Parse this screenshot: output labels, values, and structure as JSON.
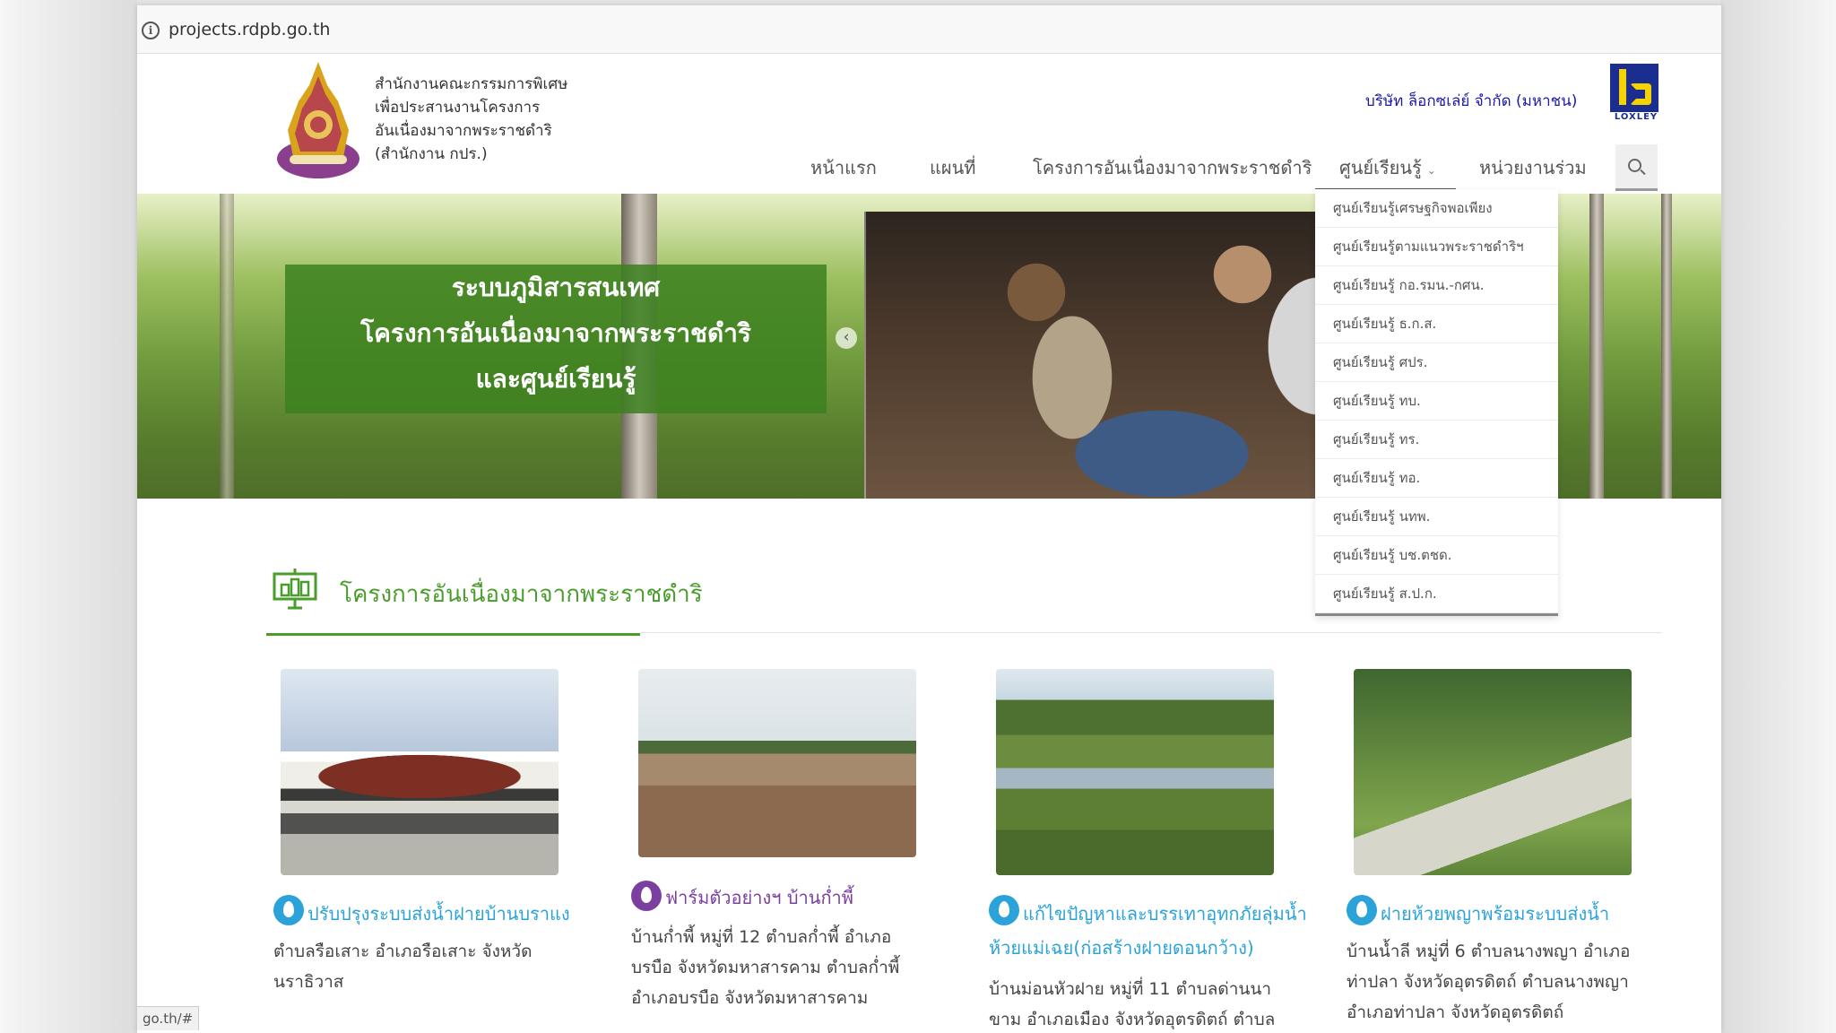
{
  "browser": {
    "url": "projects.rdpb.go.th",
    "status_url": "go.th/#"
  },
  "header": {
    "org_name_lines": [
      "สำนักงานคณะกรรมการพิเศษ",
      "เพื่อประสานงานโครงการ",
      "อันเนื่องมาจากพระราชดำริ",
      "(สำนักงาน กปร.)"
    ],
    "company": "บริษัท ล็อกซเล่ย์ จำกัด (มหาชน)",
    "loxley_label": "LOXLEY"
  },
  "nav": {
    "items": [
      {
        "label": "หน้าแรก"
      },
      {
        "label": "แผนที่"
      },
      {
        "label": "โครงการอันเนื่องมาจากพระราชดำริ"
      },
      {
        "label": "ศูนย์เรียนรู้"
      },
      {
        "label": "หน่วยงานร่วม"
      }
    ]
  },
  "dropdown": {
    "items": [
      "ศูนย์เรียนรู้เศรษฐกิจพอเพียง",
      "ศูนย์เรียนรู้ตามแนวพระราชดำริฯ",
      "ศูนย์เรียนรู้ กอ.รมน.-กศน.",
      "ศูนย์เรียนรู้ ธ.ก.ส.",
      "ศูนย์เรียนรู้ ศปร.",
      "ศูนย์เรียนรู้ ทบ.",
      "ศูนย์เรียนรู้ ทร.",
      "ศูนย์เรียนรู้ ทอ.",
      "ศูนย์เรียนรู้ นทพ.",
      "ศูนย์เรียนรู้ บช.ตชด.",
      "ศูนย์เรียนรู้ ส.ป.ก."
    ]
  },
  "hero": {
    "lines": [
      "ระบบภูมิสารสนเทศ",
      "โครงการอันเนื่องมาจากพระราชดำริ",
      "และศูนย์เรียนรู้"
    ],
    "prev_icon": "‹"
  },
  "section": {
    "title": "โครงการอันเนื่องมาจากพระราชดำริ"
  },
  "cards": [
    {
      "title_lines": [
        "ปรับปรุงระบบส่งน้ำฝายบ้านบราแง"
      ],
      "desc_lines": [
        "ตำบลรือเสาะ อำเภอรือเสาะ จังหวัด",
        "นราธิวาส"
      ],
      "pin_color": "#2ba3d8",
      "title_color": "#2ba3d8"
    },
    {
      "title_lines": [
        "ฟาร์มตัวอย่างฯ บ้านก่ำพี้"
      ],
      "desc_lines": [
        "บ้านก่ำพี้ หมู่ที่ 12 ตำบลก่ำพี้ อำเภอ",
        "บรบือ จังหวัดมหาสารคาม ตำบลก่ำพี้",
        "อำเภอบรบือ จังหวัดมหาสารคาม"
      ],
      "pin_color": "#7b3fa0",
      "title_color": "#7b3fa0"
    },
    {
      "title_lines": [
        "แก้ไขปัญหาและบรรเทาอุทกภัยลุ่มน้ำ",
        "ห้วยแม่เฉย(ก่อสร้างฝายดอนกว้าง)"
      ],
      "desc_lines": [
        "บ้านม่อนหัวฝาย หมู่ที่ 11 ตำบลด่านนา",
        "ขาม อำเภอเมือง จังหวัดอุตรดิตถ์ ตำบล"
      ],
      "pin_color": "#2ba3d8",
      "title_color": "#2ba3d8"
    },
    {
      "title_lines": [
        "ฝายห้วยพญาพร้อมระบบส่งน้ำ"
      ],
      "desc_lines": [
        "บ้านน้ำลี หมู่ที่ 6 ตำบลนางพญา อำเภอ",
        "ท่าปลา จังหวัดอุตรดิตถ์ ตำบลนางพญา",
        "อำเภอท่าปลา จังหวัดอุตรดิตถ์"
      ],
      "pin_color": "#2ba3d8",
      "title_color": "#2ba3d8"
    }
  ]
}
